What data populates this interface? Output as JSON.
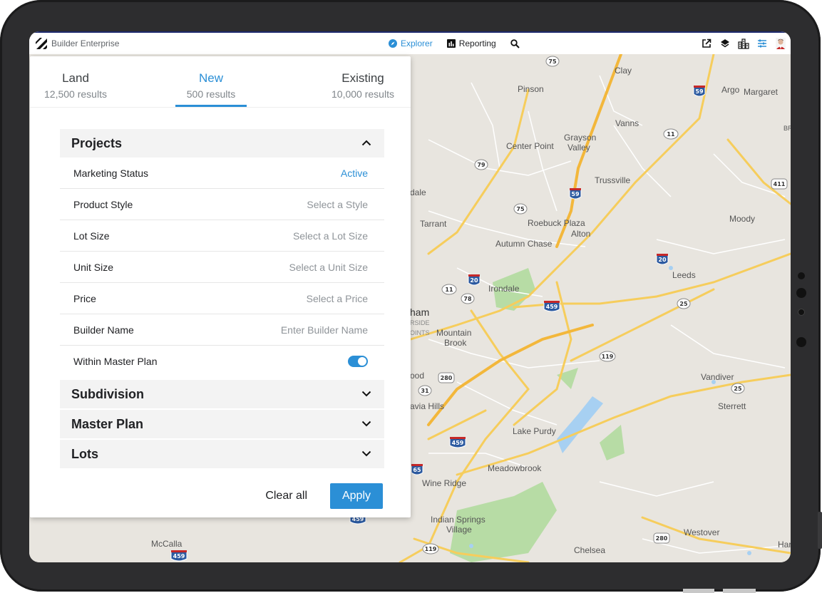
{
  "app": {
    "brand": "Builder Enterprise",
    "nav": [
      {
        "label": "Explorer",
        "icon": "compass-icon",
        "active": true
      },
      {
        "label": "Reporting",
        "icon": "bar-chart-icon",
        "active": false
      }
    ],
    "toolbar_icons": [
      "search-icon",
      "external-link-icon",
      "layers-icon",
      "buildings-icon",
      "filter-sliders-icon",
      "avatar"
    ]
  },
  "panel": {
    "tabs": [
      {
        "label": "Land",
        "count": "12,500 results"
      },
      {
        "label": "New",
        "count": "500 results",
        "selected": true
      },
      {
        "label": "Existing",
        "count": "10,000 results"
      }
    ],
    "sections": {
      "projects": {
        "title": "Projects",
        "expanded": true,
        "rows": [
          {
            "label": "Marketing Status",
            "value": "Active"
          },
          {
            "label": "Product Style",
            "value": "Select a Style"
          },
          {
            "label": "Lot Size",
            "value": "Select a Lot Size"
          },
          {
            "label": "Unit Size",
            "value": "Select a Unit Size"
          },
          {
            "label": "Price",
            "value": "Select a Price"
          },
          {
            "label": "Builder Name",
            "value": "Enter Builder Name"
          },
          {
            "label": "Within Master Plan",
            "toggle": true
          }
        ]
      },
      "subdivision": {
        "title": "Subdivision"
      },
      "master_plan": {
        "title": "Master Plan"
      },
      "lots": {
        "title": "Lots"
      }
    },
    "actions": {
      "clear": "Clear all",
      "apply": "Apply"
    }
  },
  "map": {
    "places": [
      "Clay",
      "Pinson",
      "Argo",
      "Margaret",
      "Vanns",
      "Center Point",
      "Grayson",
      "Valley",
      "Trussville",
      "dale",
      "Tarrant",
      "Roebuck Plaza",
      "Alton",
      "Moody",
      "Autumn Chase",
      "Leeds",
      "Irondale",
      "ham",
      "RSIDE",
      "OINTS",
      "Mountain",
      "Brook",
      "ood",
      "avia Hills",
      "Vandiver",
      "Sterrett",
      "Lake Purdy",
      "Meadowbrook",
      "Wine Ridge",
      "Indian Springs",
      "Village",
      "Westover",
      "McCalla",
      "Chelsea",
      "Har",
      "BR"
    ],
    "shields": [
      "75",
      "59",
      "11",
      "79",
      "59",
      "411",
      "75",
      "20",
      "20",
      "11",
      "78",
      "459",
      "25",
      "119",
      "280",
      "31",
      "25",
      "459",
      "65",
      "459",
      "280",
      "459",
      "119"
    ]
  },
  "colors": {
    "accent": "#2b8fd6",
    "map_land": "#e9e6e0",
    "map_road": "#f6cd5c",
    "map_water": "#a7d0f2",
    "map_park": "#b5dba4",
    "frame": "#2d2d2f"
  }
}
